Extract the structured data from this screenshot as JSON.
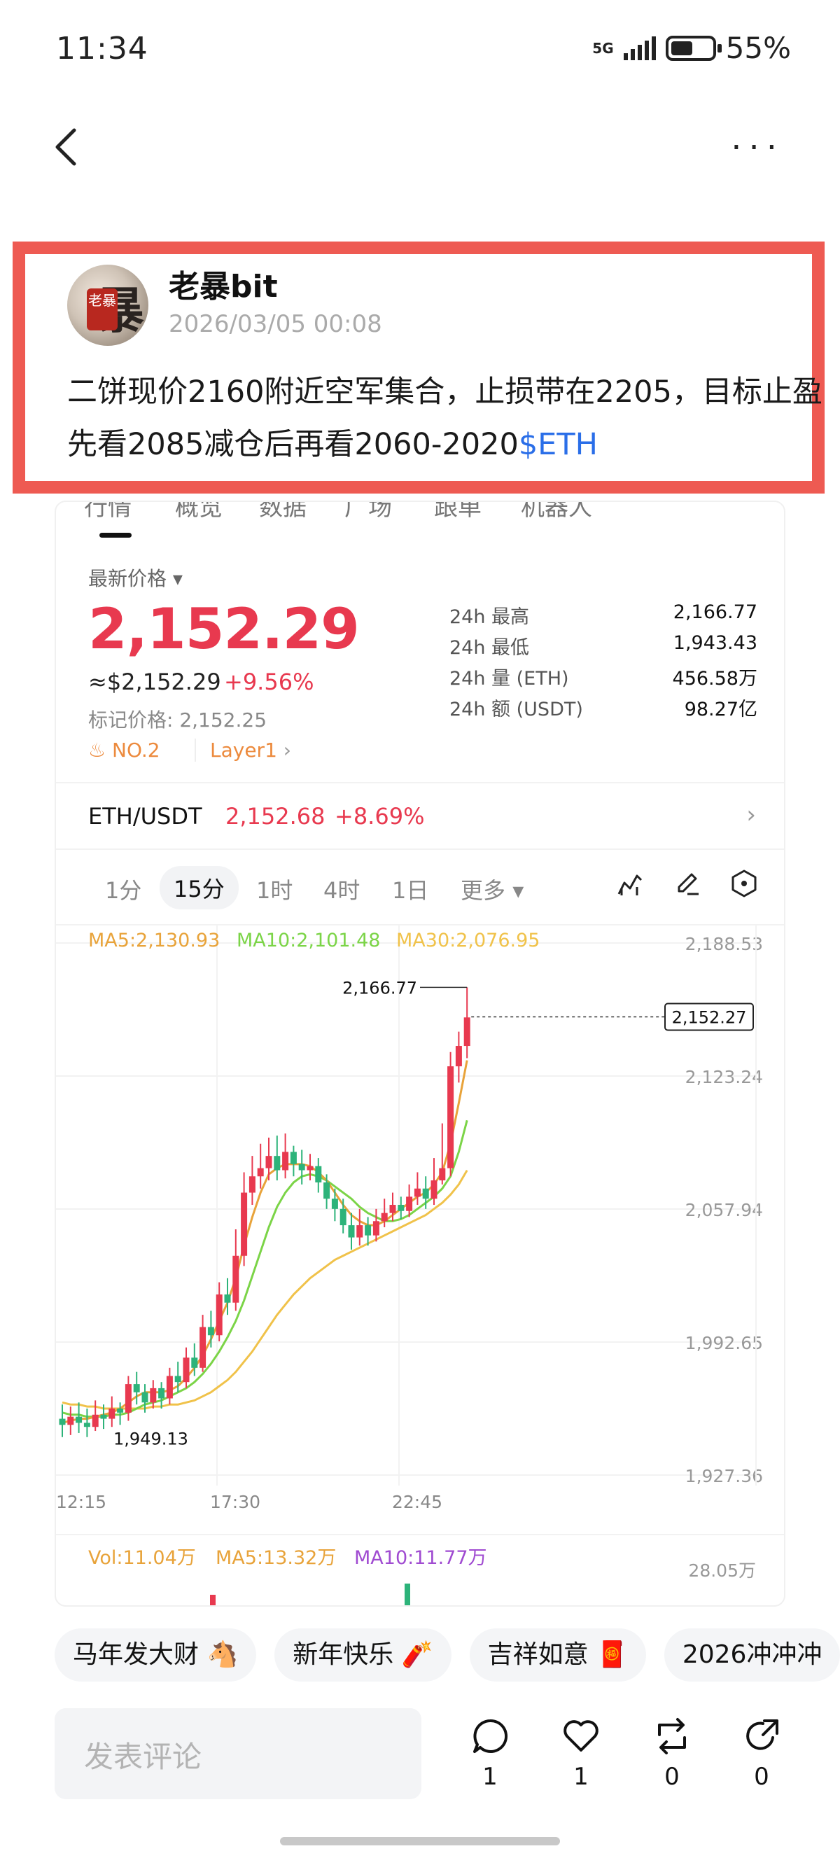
{
  "status_bar": {
    "time": "11:34",
    "network": "5G",
    "battery_pct": "55%",
    "battery_level": 0.55
  },
  "post": {
    "author": "老暴bit",
    "timestamp": "2026/03/05 00:08",
    "avatar_text": "老暴",
    "text": "二饼现价2160附近空军集合，止损带在2205，目标止盈先看2085减仓后再看2060-2020",
    "hashtag": "$ETH"
  },
  "market": {
    "tabs": [
      "行情",
      "概览",
      "数据",
      "广场",
      "跟单",
      "机器人"
    ],
    "latest_label": "最新价格",
    "price": "2,152.29",
    "usd_price": "≈$2,152.29",
    "change": "+9.56%",
    "mark_price": "标记价格: 2,152.25",
    "rank": "NO.2",
    "category": "Layer1",
    "stats": [
      {
        "label": "24h  最高",
        "value": "2,166.77"
      },
      {
        "label": "24h  最低",
        "value": "1,943.43"
      },
      {
        "label": "24h  量 (ETH)",
        "value": "456.58万"
      },
      {
        "label": "24h  额 (USDT)",
        "value": "98.27亿"
      }
    ],
    "pair": {
      "name": "ETH/USDT",
      "price": "2,152.68",
      "change": "+8.69%"
    },
    "timeframes": [
      "1分",
      "15分",
      "1时",
      "4时",
      "1日",
      "更多"
    ],
    "active_timeframe": "15分"
  },
  "chart_data": {
    "type": "candlestick",
    "ma_labels": {
      "ma5": "MA5:2,130.93",
      "ma10": "MA10:2,101.48",
      "ma30": "MA30:2,076.95"
    },
    "y_ticks": [
      "2,188.53",
      "2,123.24",
      "2,057.94",
      "1,992.65",
      "1,927.36"
    ],
    "ylim": [
      1927.36,
      2188.53
    ],
    "x_ticks": [
      "12:15",
      "17:30",
      "22:45"
    ],
    "high_label": "2,166.77",
    "low_label": "1,949.13",
    "current_price_label": "2,152.27",
    "current_price": 2152.27,
    "colors": {
      "up": "#e8394f",
      "down": "#2db37a",
      "ma5": "#e8a33a",
      "ma10": "#7bd447",
      "ma30": "#f0c24a"
    },
    "candles": [
      [
        1955,
        1952,
        1962,
        1946
      ],
      [
        1952,
        1956,
        1961,
        1947
      ],
      [
        1956,
        1953,
        1963,
        1948
      ],
      [
        1953,
        1951,
        1960,
        1946
      ],
      [
        1951,
        1957,
        1964,
        1949
      ],
      [
        1957,
        1955,
        1962,
        1950
      ],
      [
        1955,
        1960,
        1966,
        1951
      ],
      [
        1960,
        1958,
        1963,
        1952
      ],
      [
        1958,
        1972,
        1976,
        1954
      ],
      [
        1972,
        1968,
        1978,
        1962
      ],
      [
        1968,
        1963,
        1972,
        1958
      ],
      [
        1963,
        1970,
        1974,
        1960
      ],
      [
        1970,
        1965,
        1973,
        1960
      ],
      [
        1965,
        1976,
        1980,
        1962
      ],
      [
        1976,
        1973,
        1983,
        1968
      ],
      [
        1973,
        1985,
        1990,
        1970
      ],
      [
        1985,
        1980,
        1992,
        1976
      ],
      [
        1980,
        2000,
        2006,
        1978
      ],
      [
        2000,
        1996,
        2008,
        1990
      ],
      [
        1996,
        2016,
        2022,
        1993
      ],
      [
        2016,
        2012,
        2024,
        2006
      ],
      [
        2012,
        2035,
        2048,
        2008
      ],
      [
        2035,
        2066,
        2076,
        2030
      ],
      [
        2066,
        2074,
        2084,
        2060
      ],
      [
        2074,
        2078,
        2090,
        2068
      ],
      [
        2078,
        2084,
        2093,
        2072
      ],
      [
        2084,
        2077,
        2094,
        2072
      ],
      [
        2077,
        2086,
        2095,
        2073
      ],
      [
        2086,
        2080,
        2089,
        2074
      ],
      [
        2080,
        2077,
        2087,
        2070
      ],
      [
        2077,
        2079,
        2085,
        2072
      ],
      [
        2079,
        2071,
        2083,
        2066
      ],
      [
        2071,
        2063,
        2075,
        2058
      ],
      [
        2063,
        2058,
        2068,
        2052
      ],
      [
        2058,
        2050,
        2063,
        2046
      ],
      [
        2050,
        2044,
        2056,
        2038
      ],
      [
        2044,
        2050,
        2058,
        2040
      ],
      [
        2050,
        2045,
        2054,
        2040
      ],
      [
        2045,
        2052,
        2058,
        2042
      ],
      [
        2052,
        2056,
        2063,
        2049
      ],
      [
        2056,
        2060,
        2066,
        2052
      ],
      [
        2060,
        2057,
        2064,
        2053
      ],
      [
        2057,
        2064,
        2070,
        2054
      ],
      [
        2064,
        2068,
        2076,
        2060
      ],
      [
        2068,
        2063,
        2074,
        2058
      ],
      [
        2063,
        2072,
        2083,
        2060
      ],
      [
        2072,
        2078,
        2100,
        2070
      ],
      [
        2078,
        2128,
        2135,
        2074
      ],
      [
        2128,
        2138,
        2145,
        2120
      ],
      [
        2138,
        2152,
        2166.77,
        2132
      ]
    ],
    "ma5": [
      1953,
      1954,
      1955,
      1955,
      1956,
      1957,
      1958,
      1960,
      1963,
      1966,
      1968,
      1968,
      1968,
      1969,
      1971,
      1975,
      1980,
      1986,
      1994,
      2003,
      2012,
      2024,
      2040,
      2054,
      2066,
      2075,
      2078,
      2080,
      2080,
      2080,
      2079,
      2076,
      2072,
      2066,
      2060,
      2055,
      2052,
      2050,
      2050,
      2052,
      2055,
      2058,
      2061,
      2064,
      2066,
      2070,
      2076,
      2090,
      2110,
      2130.93
    ],
    "ma10": [
      1958,
      1957,
      1957,
      1956,
      1956,
      1956,
      1957,
      1957,
      1958,
      1960,
      1962,
      1963,
      1964,
      1966,
      1968,
      1970,
      1973,
      1977,
      1982,
      1988,
      1995,
      2003,
      2013,
      2025,
      2037,
      2049,
      2059,
      2066,
      2071,
      2074,
      2075,
      2074,
      2072,
      2069,
      2066,
      2063,
      2059,
      2056,
      2054,
      2052,
      2052,
      2053,
      2055,
      2058,
      2061,
      2064,
      2068,
      2074,
      2086,
      2101.48
    ],
    "ma30": [
      1963,
      1962,
      1962,
      1961,
      1961,
      1960,
      1960,
      1960,
      1960,
      1960,
      1960,
      1961,
      1961,
      1962,
      1962,
      1963,
      1964,
      1966,
      1968,
      1971,
      1974,
      1978,
      1983,
      1988,
      1994,
      2000,
      2006,
      2011,
      2016,
      2020,
      2024,
      2027,
      2030,
      2033,
      2035,
      2037,
      2039,
      2041,
      2043,
      2045,
      2047,
      2049,
      2051,
      2053,
      2055,
      2058,
      2061,
      2065,
      2070,
      2076.95
    ],
    "volume_labels": {
      "vol": "Vol:11.04万",
      "ma5": "MA5:13.32万",
      "ma10": "MA10:11.77万"
    },
    "volume_max_label": "28.05万"
  },
  "chips": [
    "马年发大财 🐴",
    "新年快乐 🧨",
    "吉祥如意 🧧",
    "2026冲冲冲"
  ],
  "footer": {
    "comment_placeholder": "发表评论",
    "actions": [
      {
        "icon": "comment-icon",
        "count": "1"
      },
      {
        "icon": "heart-icon",
        "count": "1"
      },
      {
        "icon": "repost-icon",
        "count": "0"
      },
      {
        "icon": "share-icon",
        "count": "0"
      }
    ]
  }
}
